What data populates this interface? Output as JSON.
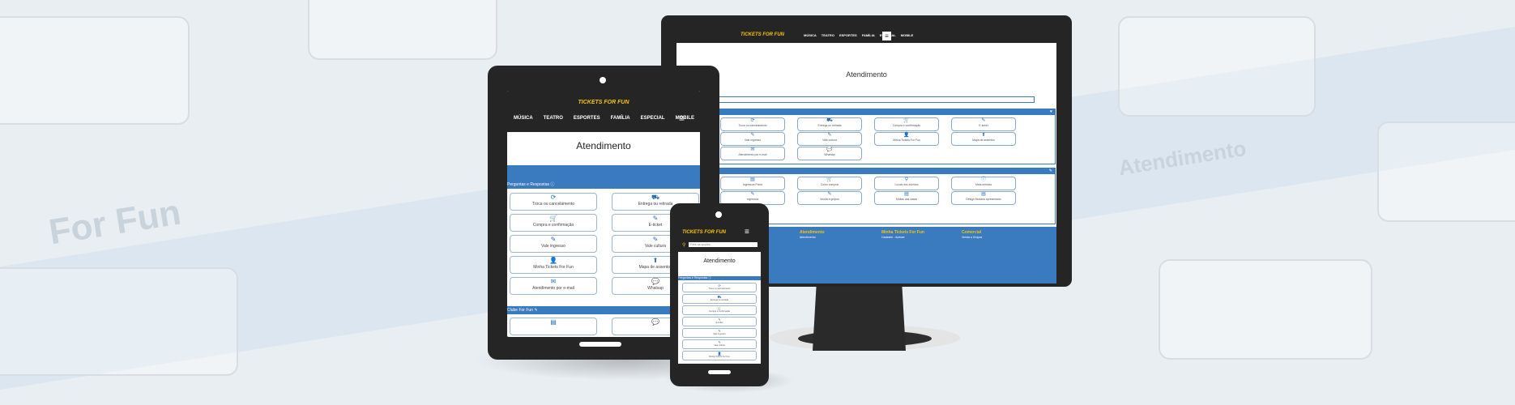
{
  "brand": {
    "logo": "TICKETS FOR FUN",
    "yellow": "#f7c400",
    "blue": "#3a7abf",
    "dark": "#252525"
  },
  "nav": {
    "items": [
      "MÚSICA",
      "TEATRO",
      "ESPORTES",
      "FAMÍLIA",
      "ESPECIAL",
      "MOBILE"
    ]
  },
  "page": {
    "title": "Atendimento"
  },
  "search": {
    "placeholder": "Filtre as opções"
  },
  "sections": {
    "faq": "Perguntas e Respostas",
    "club": "Clube For Fun"
  },
  "faq_items": [
    {
      "label": "Troca ou cancelamento",
      "icon": "refresh-icon"
    },
    {
      "label": "Entrega ou retirada",
      "icon": "truck-icon"
    },
    {
      "label": "Compra e confirmação",
      "icon": "cart-icon"
    },
    {
      "label": "E-ticket",
      "icon": "ticket-icon"
    },
    {
      "label": "Vale ingresso",
      "icon": "ticket-icon"
    },
    {
      "label": "Vale cultura",
      "icon": "ticket-icon"
    },
    {
      "label": "Minha Tickets For Fun",
      "icon": "user-icon"
    },
    {
      "label": "Mapa de assentos",
      "icon": "seat-icon"
    },
    {
      "label": "Atendimento por e-mail",
      "icon": "envelope-icon"
    },
    {
      "label": "Whatsap",
      "icon": "chat-icon"
    }
  ],
  "desktop_club_items": [
    {
      "label": "Ingressos Prime",
      "icon": "book-icon"
    },
    {
      "label": "Como comprar",
      "icon": "cart-icon"
    },
    {
      "label": "Locais dos eventos",
      "icon": "pin-icon"
    },
    {
      "label": "Meia-entrada",
      "icon": "info-icon"
    },
    {
      "label": "Ingressos",
      "icon": "ticket-icon"
    },
    {
      "label": "Venda a grupos",
      "icon": "ticket-icon"
    },
    {
      "label": "Mídias das casas",
      "icon": "book-icon"
    },
    {
      "label": "Design Mozaria apresentado",
      "icon": "book-icon"
    }
  ],
  "footer": {
    "col1": "Atendimento",
    "col1_sub": "Atendimento",
    "col2": "Minha Tickets For Fun",
    "col2_sub": "Cadastre - Acesse",
    "col3": "Comercial",
    "col3_sub": "Venda a Grupos"
  }
}
